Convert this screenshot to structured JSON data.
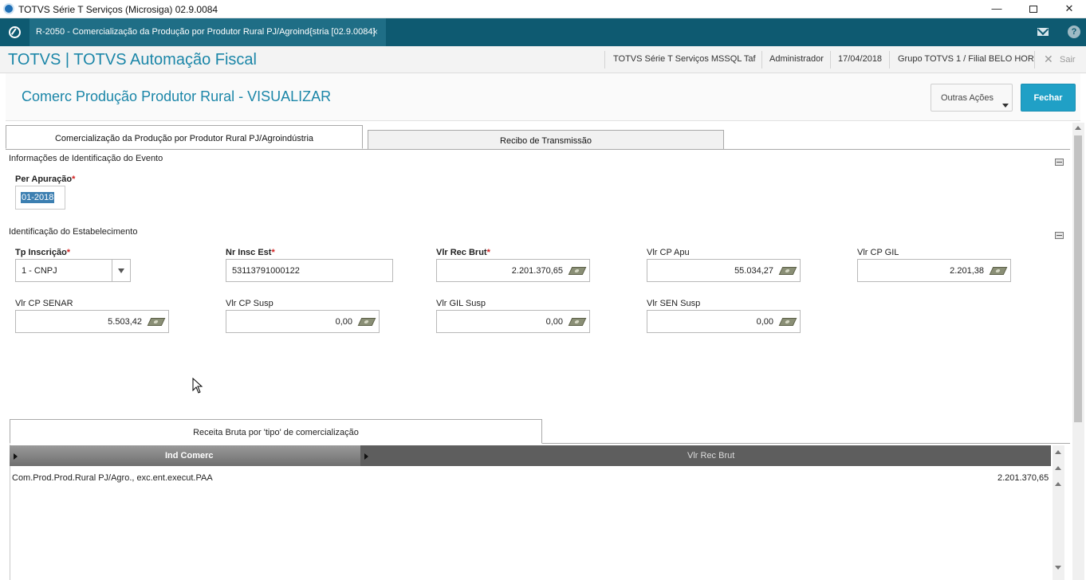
{
  "window": {
    "title": "TOTVS Série T Serviços (Microsiga) 02.9.0084",
    "minimize": "—",
    "close": "✕"
  },
  "tabbar": {
    "active_tab": "R-2050 - Comercialização da Produção por Produtor Rural PJ/Agroind{stria [02.9.0084]",
    "tab_close": "×",
    "help": "?"
  },
  "header": {
    "app_name": "TOTVS | TOTVS Automação Fiscal",
    "environment": "TOTVS Série T Serviços MSSQL Taf",
    "user": "Administrador",
    "date": "17/04/2018",
    "branch": "Grupo TOTVS 1 / Filial BELO HOR",
    "exit_icon": "✕",
    "exit": "Sair"
  },
  "page": {
    "title": "Comerc Produção Produtor Rural - VISUALIZAR",
    "other_actions": "Outras Ações",
    "close": "Fechar"
  },
  "folders": [
    {
      "label": "Comercialização da Produção por Produtor Rural PJ/Agroindústria",
      "active": true
    },
    {
      "label": "Recibo de Transmissão",
      "active": false
    }
  ],
  "event_section": {
    "title": "Informações de Identificação do Evento",
    "period_label": "Per Apuração",
    "period_value": "01-2018"
  },
  "establishment_section": {
    "title": "Identificação do Estabelecimento",
    "required_mark": "*",
    "fields": {
      "tp_inscricao": {
        "label": "Tp Inscrição",
        "value": "1 - CNPJ"
      },
      "nr_insc_est": {
        "label": "Nr Insc Est",
        "value": "53113791000122"
      },
      "vlr_rec_brut": {
        "label": "Vlr Rec Brut",
        "value": "2.201.370,65"
      },
      "vlr_cp_apu": {
        "label": "Vlr CP Apu",
        "value": "55.034,27"
      },
      "vlr_cp_gil": {
        "label": "Vlr CP GIL",
        "value": "2.201,38"
      },
      "vlr_cp_senar": {
        "label": "Vlr CP SENAR",
        "value": "5.503,42"
      },
      "vlr_cp_susp": {
        "label": "Vlr CP Susp",
        "value": "0,00"
      },
      "vlr_gil_susp": {
        "label": "Vlr GIL Susp",
        "value": "0,00"
      },
      "vlr_sen_susp": {
        "label": "Vlr SEN Susp",
        "value": "0,00"
      }
    }
  },
  "revenue_grid": {
    "tab_label": "Receita Bruta por 'tipo' de comercialização",
    "columns": [
      "Ind Comerc",
      "Vlr Rec Brut"
    ],
    "rows": [
      [
        "Com.Prod.Prod.Rural PJ/Agro., exc.ent.execut.PAA",
        "2.201.370,65"
      ]
    ]
  }
}
